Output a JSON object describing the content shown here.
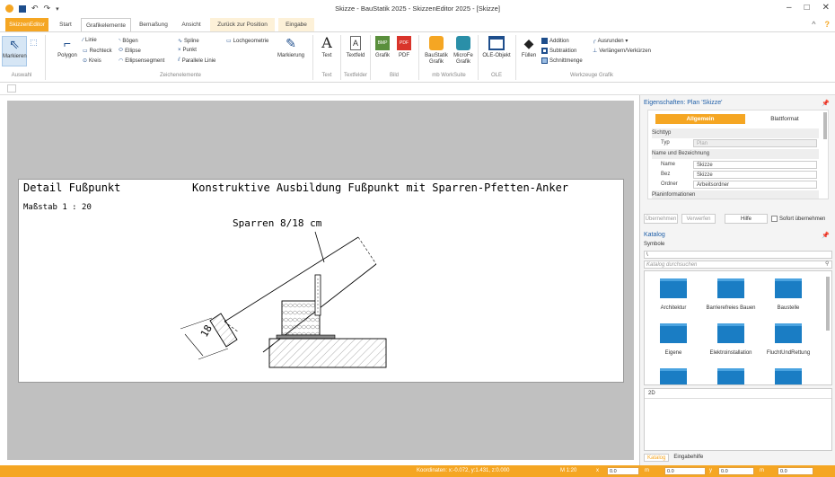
{
  "window": {
    "title": "Skizze - BauStatik 2025 - SkizzenEditor 2025 - [Skizze]",
    "controls": [
      "–",
      "□",
      "✕"
    ]
  },
  "tabs": {
    "app": "SkizzenEditor",
    "items": [
      "Start",
      "Grafikelemente",
      "Bemaßung",
      "Ansicht"
    ],
    "context": [
      "Zurück zur Position",
      "Eingabe"
    ]
  },
  "ribbon": {
    "auswahl": {
      "select": "Markieren",
      "label": "Auswahl"
    },
    "zeichenelemente": {
      "polygon": "Polygon",
      "linie": "Linie",
      "rechteck": "Rechteck",
      "kreis": "Kreis",
      "boegen": "Bögen",
      "ellipse": "Ellipse",
      "ellipsensegment": "Ellipsensegment",
      "spline": "Spline",
      "punkt": "Punkt",
      "parallele": "Parallele Linie",
      "lochgeometrie": "Lochgeometrie",
      "markierung": "Markierung",
      "label": "Zeichenelemente"
    },
    "text": {
      "text": "Text",
      "label": "Text"
    },
    "textfelder": {
      "textfeld": "Textfeld",
      "label": "Textfelder"
    },
    "bild": {
      "grafik": "Grafik",
      "pdf": "PDF",
      "label": "Bild"
    },
    "mb": {
      "baustatik": "BauStatik Grafik",
      "microfe": "MicroFe Grafik",
      "label": "mb WorkSuite"
    },
    "ole": {
      "objekt": "OLE-Objekt",
      "label": "OLE"
    },
    "werkzeuge": {
      "fuellen": "Füllen",
      "addition": "Addition",
      "subtraktion": "Subtraktion",
      "schnittmenge": "Schnittmenge",
      "ausrunden": "Ausrunden ▾",
      "verlaengern": "Verlängern/Verkürzen",
      "label": "Werkzeuge Grafik"
    },
    "right_icons": [
      "^",
      "?"
    ]
  },
  "drawing": {
    "title_left": "Detail Fußpunkt",
    "title_right": "Konstruktive Ausbildung Fußpunkt mit Sparren-Pfetten-Anker",
    "scale": "Maßstab 1 : 20",
    "sparren_label": "Sparren 8/18 cm",
    "dim_label": "18"
  },
  "properties": {
    "header": "Eigenschaften: Plan 'Skizze'",
    "tab_general": "Allgemein",
    "tab_format": "Blattformat",
    "sections": {
      "sichttyp": "Sichttyp",
      "name_bez": "Name und Bezeichnung",
      "more": "Planinformationen"
    },
    "rows": {
      "typ_label": "Typ",
      "typ_value": "Plan",
      "name_label": "Name",
      "name_value": "Skizze",
      "bez_label": "Bez",
      "bez_value": "Skizze",
      "ordner_label": "Ordner",
      "ordner_value": "Arbeitsordner"
    },
    "buttons": {
      "uebernehmen": "Übernehmen",
      "verwerfen": "Verwerfen",
      "hilfe": "Hilfe",
      "sofort": "Sofort übernehmen"
    }
  },
  "catalog": {
    "header": "Katalog",
    "symbols": "Symbole",
    "path": "\\",
    "search_placeholder": "Katalog durchsuchen",
    "items": [
      "Architektur",
      "Barrierefreies Bauen",
      "Baustelle",
      "Eigene",
      "Elektroinstallation",
      "FluchtUndRettung",
      "",
      "",
      ""
    ],
    "preview_label": "2D",
    "bottom_tabs": [
      "Katalog",
      "Eingabehilfe"
    ]
  },
  "status": {
    "coords": "Koordinaten: x:-0.072, y:1.431, z:0.000",
    "scale": "M 1:20",
    "fields": [
      {
        "label": "x",
        "value": "0.0"
      },
      {
        "label": "m",
        "value": "0.0"
      },
      {
        "label": "y",
        "value": "0.0"
      },
      {
        "label": "m",
        "value": "0.0"
      }
    ]
  }
}
